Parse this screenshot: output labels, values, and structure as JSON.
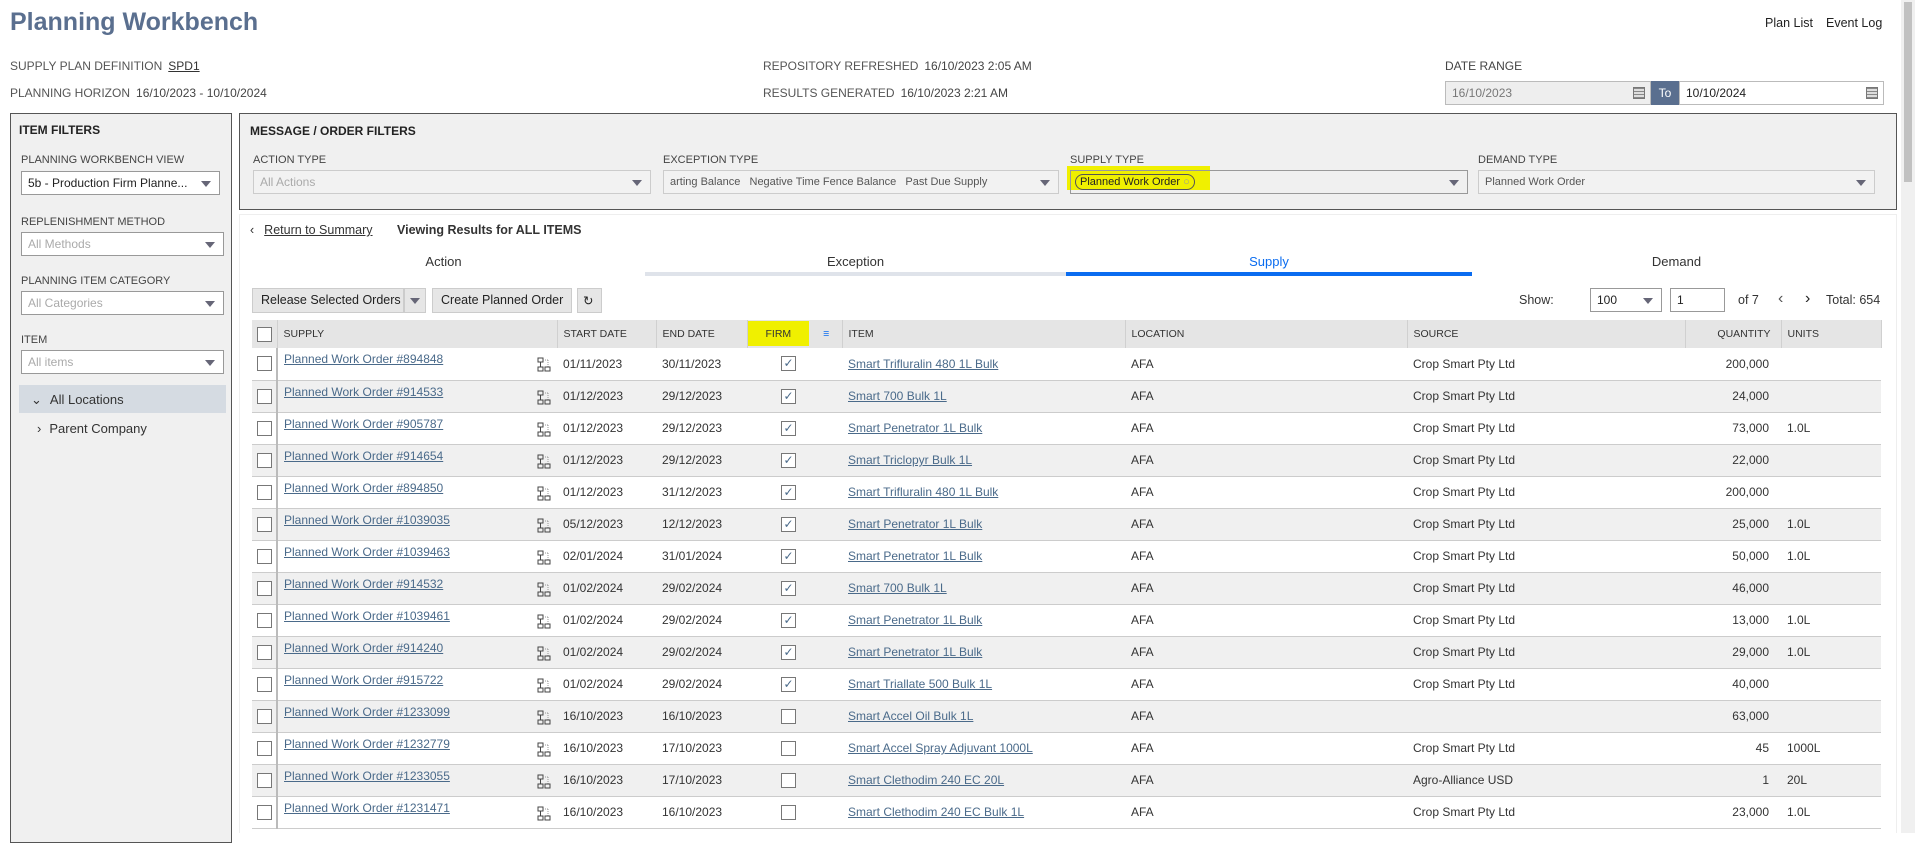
{
  "header": {
    "title": "Planning Workbench",
    "links": [
      "Plan List",
      "Event Log"
    ]
  },
  "meta": {
    "supply_plan_label": "SUPPLY PLAN DEFINITION",
    "supply_plan_value": "SPD1",
    "horizon_label": "PLANNING HORIZON",
    "horizon_value": "16/10/2023 - 10/10/2024",
    "refreshed_label": "REPOSITORY REFRESHED",
    "refreshed_value": "16/10/2023 2:05 AM",
    "generated_label": "RESULTS GENERATED",
    "generated_value": "16/10/2023 2:21 AM",
    "date_range_label": "DATE RANGE",
    "date_from": "16/10/2023",
    "date_to_label": "To",
    "date_to": "10/10/2024"
  },
  "item_filters": {
    "title": "ITEM FILTERS",
    "view_label": "PLANNING WORKBENCH VIEW",
    "view_value": "5b - Production Firm Planne...",
    "replenishment_label": "REPLENISHMENT METHOD",
    "replenishment_placeholder": "All Methods",
    "category_label": "PLANNING ITEM CATEGORY",
    "category_placeholder": "All Categories",
    "item_label": "ITEM",
    "item_placeholder": "All items",
    "tree": {
      "root": "All Locations",
      "child": "Parent Company"
    }
  },
  "order_filters": {
    "title": "MESSAGE / ORDER FILTERS",
    "action_label": "ACTION TYPE",
    "action_placeholder": "All Actions",
    "exception_label": "EXCEPTION TYPE",
    "exception_values": [
      "arting Balance",
      "Negative Time Fence Balance",
      "Past Due Supply"
    ],
    "supply_label": "SUPPLY TYPE",
    "supply_value": "Planned Work Order",
    "demand_label": "DEMAND TYPE",
    "demand_value": "Planned Work Order",
    "highlight_color": "#f0f000"
  },
  "results": {
    "return_link": "Return to Summary",
    "viewing": "Viewing Results for ALL ITEMS",
    "tabs": [
      "Action",
      "Exception",
      "Supply",
      "Demand"
    ],
    "active_tab": "Supply",
    "accent": "#0a6cf0",
    "toolbar": {
      "release": "Release Selected Orders",
      "create": "Create Planned Order",
      "show_label": "Show:",
      "show_value": "100",
      "page": "1",
      "of_pages": "of 7",
      "total": "Total: 654"
    },
    "columns": [
      "SUPPLY",
      "START DATE",
      "END DATE",
      "FIRM",
      "ITEM",
      "LOCATION",
      "SOURCE",
      "QUANTITY",
      "UNITS"
    ],
    "rows": [
      {
        "supply": "Planned Work Order #894848",
        "start": "01/11/2023",
        "end": "30/11/2023",
        "firm": true,
        "item": "Smart Trifluralin 480 1L Bulk",
        "location": "AFA",
        "source": "Crop Smart Pty Ltd",
        "qty": "200,000",
        "units": ""
      },
      {
        "supply": "Planned Work Order #914533",
        "start": "01/12/2023",
        "end": "29/12/2023",
        "firm": true,
        "item": "Smart 700 Bulk 1L",
        "location": "AFA",
        "source": "Crop Smart Pty Ltd",
        "qty": "24,000",
        "units": ""
      },
      {
        "supply": "Planned Work Order #905787",
        "start": "01/12/2023",
        "end": "29/12/2023",
        "firm": true,
        "item": "Smart Penetrator 1L Bulk",
        "location": "AFA",
        "source": "Crop Smart Pty Ltd",
        "qty": "73,000",
        "units": "1.0L"
      },
      {
        "supply": "Planned Work Order #914654",
        "start": "01/12/2023",
        "end": "29/12/2023",
        "firm": true,
        "item": "Smart Triclopyr Bulk 1L",
        "location": "AFA",
        "source": "Crop Smart Pty Ltd",
        "qty": "22,000",
        "units": ""
      },
      {
        "supply": "Planned Work Order #894850",
        "start": "01/12/2023",
        "end": "31/12/2023",
        "firm": true,
        "item": "Smart Trifluralin 480 1L Bulk",
        "location": "AFA",
        "source": "Crop Smart Pty Ltd",
        "qty": "200,000",
        "units": ""
      },
      {
        "supply": "Planned Work Order #1039035",
        "start": "05/12/2023",
        "end": "12/12/2023",
        "firm": true,
        "item": "Smart Penetrator 1L Bulk",
        "location": "AFA",
        "source": "Crop Smart Pty Ltd",
        "qty": "25,000",
        "units": "1.0L"
      },
      {
        "supply": "Planned Work Order #1039463",
        "start": "02/01/2024",
        "end": "31/01/2024",
        "firm": true,
        "item": "Smart Penetrator 1L Bulk",
        "location": "AFA",
        "source": "Crop Smart Pty Ltd",
        "qty": "50,000",
        "units": "1.0L"
      },
      {
        "supply": "Planned Work Order #914532",
        "start": "01/02/2024",
        "end": "29/02/2024",
        "firm": true,
        "item": "Smart 700 Bulk 1L",
        "location": "AFA",
        "source": "Crop Smart Pty Ltd",
        "qty": "46,000",
        "units": ""
      },
      {
        "supply": "Planned Work Order #1039461",
        "start": "01/02/2024",
        "end": "29/02/2024",
        "firm": true,
        "item": "Smart Penetrator 1L Bulk",
        "location": "AFA",
        "source": "Crop Smart Pty Ltd",
        "qty": "13,000",
        "units": "1.0L"
      },
      {
        "supply": "Planned Work Order #914240",
        "start": "01/02/2024",
        "end": "29/02/2024",
        "firm": true,
        "item": "Smart Penetrator 1L Bulk",
        "location": "AFA",
        "source": "Crop Smart Pty Ltd",
        "qty": "29,000",
        "units": "1.0L"
      },
      {
        "supply": "Planned Work Order #915722",
        "start": "01/02/2024",
        "end": "29/02/2024",
        "firm": true,
        "item": "Smart Triallate 500 Bulk 1L",
        "location": "AFA",
        "source": "Crop Smart Pty Ltd",
        "qty": "40,000",
        "units": ""
      },
      {
        "supply": "Planned Work Order #1233099",
        "start": "16/10/2023",
        "end": "16/10/2023",
        "firm": false,
        "item": "Smart Accel Oil Bulk 1L",
        "location": "AFA",
        "source": "",
        "qty": "63,000",
        "units": ""
      },
      {
        "supply": "Planned Work Order #1232779",
        "start": "16/10/2023",
        "end": "17/10/2023",
        "firm": false,
        "item": "Smart Accel Spray Adjuvant 1000L",
        "location": "AFA",
        "source": "Crop Smart Pty Ltd",
        "qty": "45",
        "units": "1000L"
      },
      {
        "supply": "Planned Work Order #1233055",
        "start": "16/10/2023",
        "end": "17/10/2023",
        "firm": false,
        "item": "Smart Clethodim 240 EC 20L",
        "location": "AFA",
        "source": "Agro-Alliance USD",
        "qty": "1",
        "units": "20L"
      },
      {
        "supply": "Planned Work Order #1231471",
        "start": "16/10/2023",
        "end": "16/10/2023",
        "firm": false,
        "item": "Smart Clethodim 240 EC Bulk 1L",
        "location": "AFA",
        "source": "Crop Smart Pty Ltd",
        "qty": "23,000",
        "units": "1.0L"
      }
    ]
  }
}
